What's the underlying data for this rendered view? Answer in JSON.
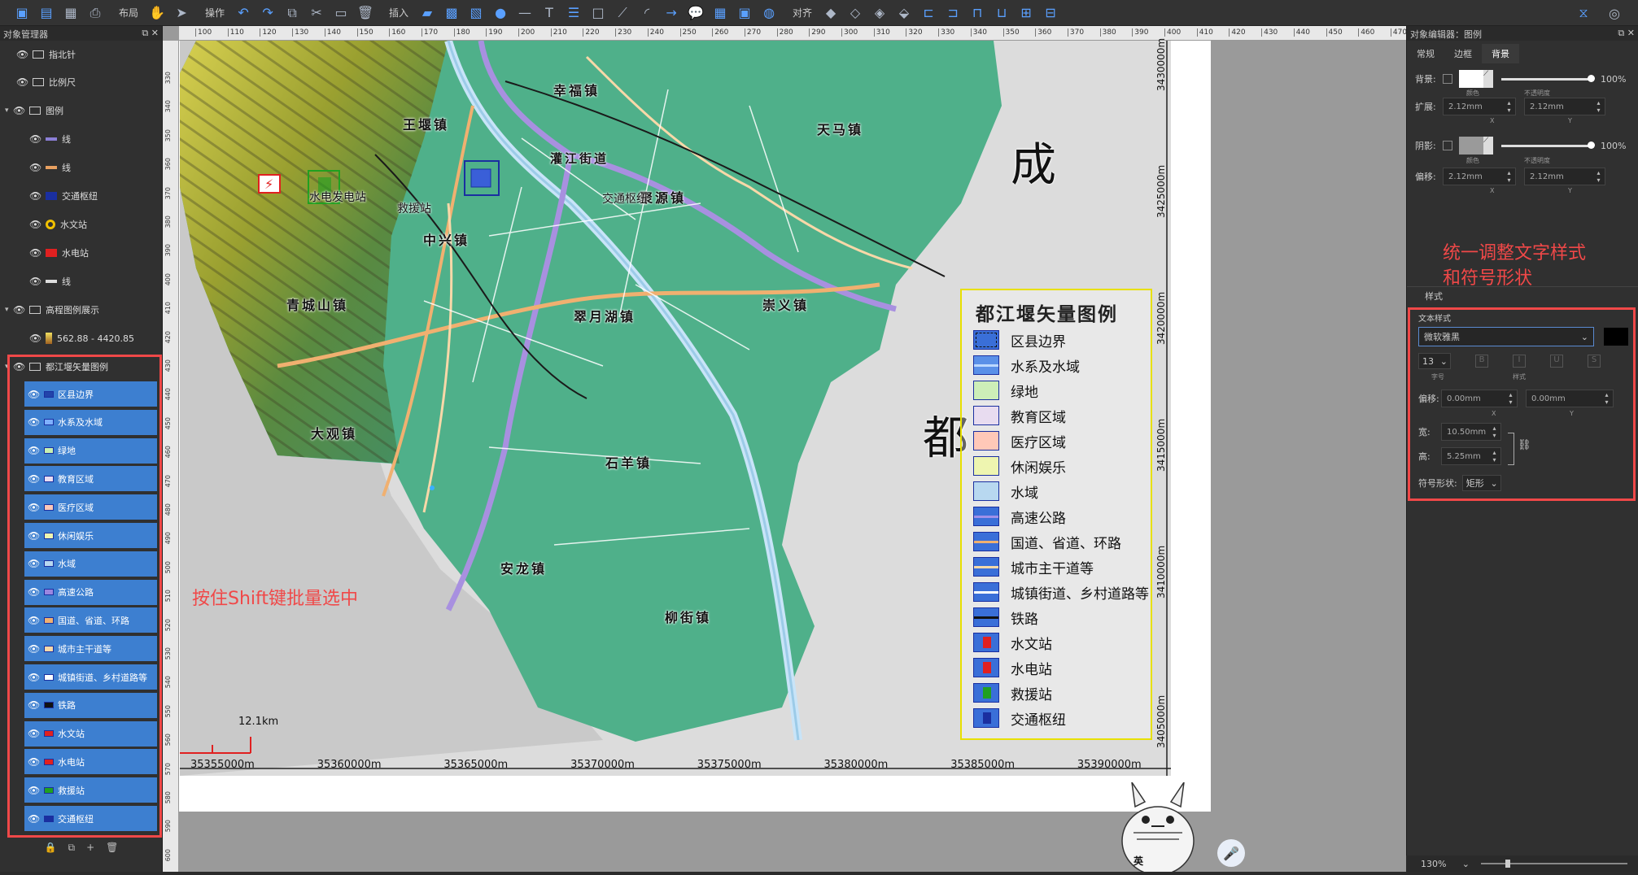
{
  "toolbar": {
    "groups": [
      "布局",
      "操作",
      "插入",
      "对齐"
    ]
  },
  "object_manager": {
    "title": "对象管理器",
    "tree": [
      {
        "label": "指北针",
        "icon": "compass-icon"
      },
      {
        "label": "比例尺",
        "icon": "scalebar-icon"
      },
      {
        "label": "图例",
        "icon": "legend-icon"
      },
      {
        "label": "线",
        "icon": "line-symbol",
        "color": "#8b7fd6"
      },
      {
        "label": "线",
        "icon": "line-symbol",
        "color": "#e8a060"
      },
      {
        "label": "交通枢纽",
        "icon": "transit-symbol",
        "color": "#1a2fa0"
      },
      {
        "label": "水文站",
        "icon": "hydro-station-symbol",
        "color": "#f0c000"
      },
      {
        "label": "水电站",
        "icon": "power-station-symbol",
        "color": "#e02020"
      },
      {
        "label": "线",
        "icon": "line-symbol",
        "color": "#ddd"
      },
      {
        "label": "高程图例展示",
        "icon": "legend-icon"
      },
      {
        "label": "562.88 - 4420.85",
        "icon": "gradient-symbol"
      },
      {
        "label": "都江堰矢量图例",
        "icon": "legend-icon"
      }
    ],
    "selected_items": [
      {
        "label": "区县边界",
        "color": "#2244aa"
      },
      {
        "label": "水系及水域",
        "color": "#7fb0ff"
      },
      {
        "label": "绿地",
        "color": "#c8f0b0"
      },
      {
        "label": "教育区域",
        "color": "#e8dcf0"
      },
      {
        "label": "医疗区域",
        "color": "#ffc8b8"
      },
      {
        "label": "休闲娱乐",
        "color": "#eef5b0"
      },
      {
        "label": "水域",
        "color": "#b8d8f0"
      },
      {
        "label": "高速公路",
        "color": "#9a86e0"
      },
      {
        "label": "国道、省道、环路",
        "color": "#f0b070"
      },
      {
        "label": "城市主干道等",
        "color": "#f8d8a8"
      },
      {
        "label": "城镇街道、乡村道路等",
        "color": "#ffffff"
      },
      {
        "label": "铁路",
        "color": "#111111"
      },
      {
        "label": "水文站",
        "color": "#e02020"
      },
      {
        "label": "水电站",
        "color": "#e02020"
      },
      {
        "label": "救援站",
        "color": "#20a020"
      },
      {
        "label": "交通枢纽",
        "color": "#1a2fa0"
      }
    ]
  },
  "ruler": {
    "top": [
      "100",
      "110",
      "120",
      "130",
      "140",
      "150",
      "160",
      "170",
      "180",
      "190",
      "200",
      "210",
      "220",
      "230",
      "240",
      "250",
      "260",
      "270",
      "280",
      "290",
      "300",
      "310",
      "320",
      "330",
      "340",
      "350",
      "360",
      "370",
      "380",
      "390",
      "400",
      "410",
      "420",
      "430",
      "440",
      "450",
      "460",
      "470"
    ],
    "left": [
      "330",
      "340",
      "350",
      "360",
      "370",
      "380",
      "390",
      "400",
      "410",
      "420",
      "430",
      "440",
      "450",
      "460",
      "470",
      "480",
      "490",
      "500",
      "510",
      "520",
      "530",
      "540",
      "550",
      "560",
      "570",
      "580",
      "590",
      "600"
    ]
  },
  "map": {
    "towns": [
      "王堰镇",
      "幸福镇",
      "天马镇",
      "中兴镇",
      "聚源镇",
      "青城山镇",
      "翠月湖镇",
      "崇义镇",
      "大观镇",
      "石羊镇",
      "安龙镇",
      "柳街镇"
    ],
    "road_text": "灌江街道",
    "big_text": [
      "成",
      "都"
    ],
    "markers": [
      "水电发电站",
      "救援站",
      "交通枢纽"
    ],
    "scalebar": "12.1km",
    "x_coords": [
      "35355000m",
      "35360000m",
      "35365000m",
      "35370000m",
      "35375000m",
      "35380000m",
      "35385000m",
      "35390000m"
    ],
    "y_coords": [
      "3430000m",
      "3425000m",
      "3420000m",
      "3415000m",
      "3410000m",
      "3405000m"
    ],
    "annotation_left": "按住Shift键批量选中",
    "annotation_right": "统一调整文字样式\n和符号形状"
  },
  "legend": {
    "title": "都江堰矢量图例",
    "items": [
      {
        "label": "区县边界",
        "fill": "#3a6fd8",
        "kind": "dashed-fill"
      },
      {
        "label": "水系及水域",
        "fill": "#5a90e8",
        "kind": "line",
        "line": "#bcd8ff"
      },
      {
        "label": "绿地",
        "fill": "#cdeeb8",
        "kind": "fill"
      },
      {
        "label": "教育区域",
        "fill": "#e8dcf0",
        "kind": "fill"
      },
      {
        "label": "医疗区域",
        "fill": "#ffc8b8",
        "kind": "fill"
      },
      {
        "label": "休闲娱乐",
        "fill": "#eef5b0",
        "kind": "fill"
      },
      {
        "label": "水域",
        "fill": "#b8d8f0",
        "kind": "fill"
      },
      {
        "label": "高速公路",
        "fill": "#3a6fd8",
        "kind": "line",
        "line": "#a090e8"
      },
      {
        "label": "国道、省道、环路",
        "fill": "#3a6fd8",
        "kind": "line",
        "line": "#f0b070"
      },
      {
        "label": "城市主干道等",
        "fill": "#3a6fd8",
        "kind": "line",
        "line": "#f8d8a8"
      },
      {
        "label": "城镇街道、乡村道路等",
        "fill": "#3a6fd8",
        "kind": "line",
        "line": "#ffffff"
      },
      {
        "label": "铁路",
        "fill": "#3a6fd8",
        "kind": "line",
        "line": "#111111"
      },
      {
        "label": "水文站",
        "fill": "#3a6fd8",
        "kind": "marker",
        "line": "#e02020"
      },
      {
        "label": "水电站",
        "fill": "#3a6fd8",
        "kind": "marker",
        "line": "#e02020"
      },
      {
        "label": "救援站",
        "fill": "#3a6fd8",
        "kind": "marker",
        "line": "#20a020"
      },
      {
        "label": "交通枢纽",
        "fill": "#3a6fd8",
        "kind": "marker",
        "line": "#1a2fa0"
      }
    ]
  },
  "object_editor": {
    "title": "对象编辑器：图例",
    "tabs": [
      "常规",
      "边框",
      "背景"
    ],
    "background_label": "背景:",
    "background_opacity": "100%",
    "color_sub": "颜色",
    "opacity_sub": "不透明度",
    "expand_label": "扩展:",
    "expand_x": "2.12mm",
    "expand_y": "2.12mm",
    "shadow_label": "阴影:",
    "shadow_opacity": "100%",
    "offset_label": "偏移:",
    "offset_x": "2.12mm",
    "offset_y": "2.12mm",
    "x_sub": "X",
    "y_sub": "Y",
    "style_section": "样式",
    "text_style_label": "文本样式",
    "font_name": "微软雅黑",
    "font_size": "13",
    "size_sub": "字号",
    "style_sub": "样式",
    "text_offset_label": "偏移:",
    "text_offset_x": "0.00mm",
    "text_offset_y": "0.00mm",
    "width_label": "宽:",
    "width_value": "10.50mm",
    "height_label": "高:",
    "height_value": "5.25mm",
    "symbol_shape_label": "符号形状:",
    "symbol_shape_value": "矩形"
  },
  "status": {
    "zoom": "130%"
  },
  "mascot_badge": "英"
}
